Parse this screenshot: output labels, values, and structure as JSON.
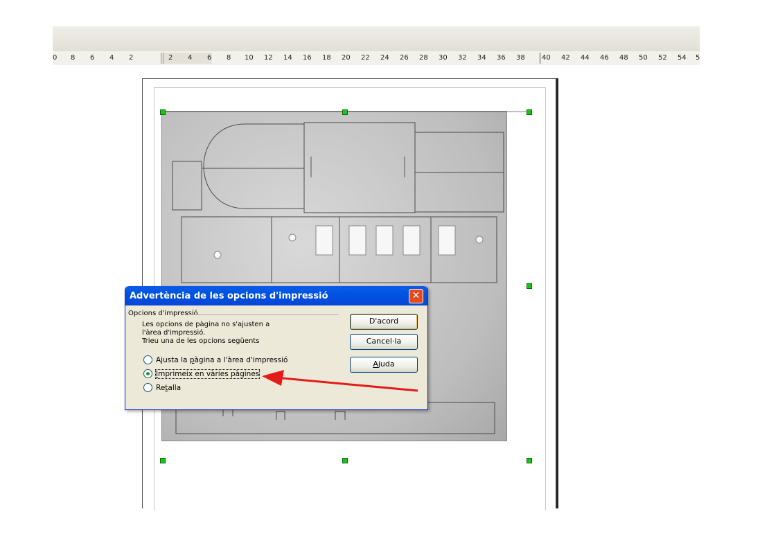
{
  "ruler": {
    "labels": [
      "0",
      "8",
      "6",
      "4",
      "2",
      "2",
      "4",
      "6",
      "8",
      "10",
      "12",
      "14",
      "16",
      "18",
      "20",
      "22",
      "24",
      "26",
      "28",
      "30",
      "32",
      "34",
      "36",
      "38",
      "40",
      "42",
      "44",
      "46",
      "48",
      "50",
      "52",
      "54",
      "5"
    ]
  },
  "dialog": {
    "title": "Advertència de les opcions d'impressió",
    "group_label": "Opcions d'impressió",
    "message": "Les opcions de pàgina no s'ajusten a l'àrea d'impressió.",
    "instruction": "Trieu una de les opcions següents",
    "options": [
      {
        "pre": "Ajusta la ",
        "acc": "p",
        "post": "àgina a l'àrea d'impressió",
        "selected": false
      },
      {
        "pre": "",
        "acc": "I",
        "post": "mprimeix en vàries pàgines",
        "selected": true
      },
      {
        "pre": "Re",
        "acc": "t",
        "post": "alla",
        "selected": false
      }
    ],
    "buttons": {
      "ok": "D'acord",
      "cancel": "Cancel·la",
      "help_pre": "",
      "help_acc": "A",
      "help_post": "juda"
    }
  },
  "colors": {
    "arrow": "#e41b17",
    "titlebar": "#0053e1",
    "handle": "#19c419"
  }
}
